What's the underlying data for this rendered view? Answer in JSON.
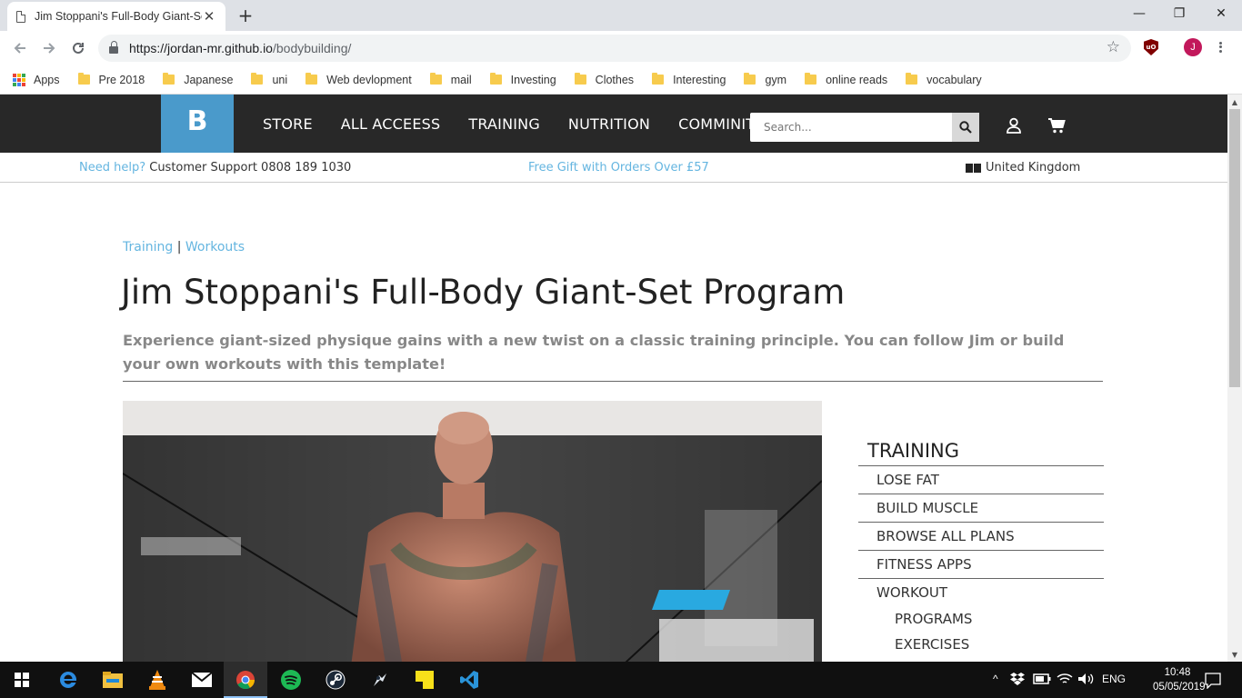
{
  "browser": {
    "tab_title": "Jim Stoppani's Full-Body Giant-Se",
    "url_host": "https://jordan-mr.github.io",
    "url_path": "/bodybuilding/",
    "profile_initial": "J",
    "bookmarks": [
      {
        "label": "Apps",
        "kind": "apps"
      },
      {
        "label": "Pre 2018",
        "kind": "folder"
      },
      {
        "label": "Japanese",
        "kind": "folder"
      },
      {
        "label": "uni",
        "kind": "folder"
      },
      {
        "label": "Web devlopment",
        "kind": "folder"
      },
      {
        "label": "mail",
        "kind": "folder"
      },
      {
        "label": "Investing",
        "kind": "folder"
      },
      {
        "label": "Clothes",
        "kind": "folder"
      },
      {
        "label": "Interesting",
        "kind": "folder"
      },
      {
        "label": "gym",
        "kind": "folder"
      },
      {
        "label": "online reads",
        "kind": "folder"
      },
      {
        "label": "vocabulary",
        "kind": "folder"
      }
    ]
  },
  "site": {
    "logo": "B",
    "nav": [
      "STORE",
      "ALL ACCEESS",
      "TRAINING",
      "NUTRITION",
      "COMMINITY"
    ],
    "search_placeholder": "Search...",
    "help_label": "Need help?",
    "help_text": " Customer Support 0808 189 1030",
    "promo": "Free Gift with Orders Over £57",
    "region": "United Kingdom",
    "accent_color": "#4a9acb"
  },
  "article": {
    "breadcrumb": [
      "Training",
      "Workouts"
    ],
    "breadcrumb_sep": " | ",
    "title": "Jim Stoppani's Full-Body Giant-Set Program",
    "subtitle": "Experience giant-sized physique gains with a new twist on a classic training principle. You can follow Jim or build your own workouts with this template!"
  },
  "sidebar": {
    "heading": "TRAINING",
    "items": [
      "LOSE FAT",
      "BUILD MUSCLE",
      "BROWSE ALL PLANS",
      "FITNESS APPS",
      "WORKOUT"
    ],
    "subitems": [
      "PROGRAMS",
      "EXERCISES"
    ]
  },
  "taskbar": {
    "language": "ENG",
    "time": "10:48",
    "date": "05/05/2019"
  }
}
